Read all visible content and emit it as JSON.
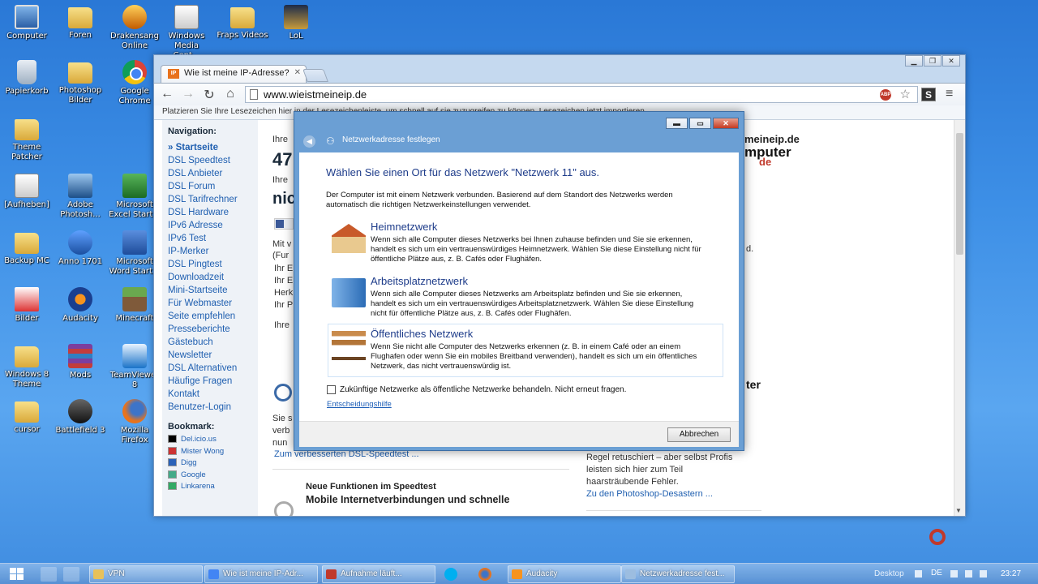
{
  "desktop_icons": [
    {
      "label": "Computer",
      "icon": "computer-icon"
    },
    {
      "label": "Foren",
      "icon": "folder-icon"
    },
    {
      "label": "Drakensang Online",
      "icon": "drakensang-icon"
    },
    {
      "label": "Windows Media Cent...",
      "icon": "media-center-icon"
    },
    {
      "label": "Fraps Videos",
      "icon": "folder-icon"
    },
    {
      "label": "LoL",
      "icon": "lol-icon"
    },
    {
      "label": "Papierkorb",
      "icon": "recycle-bin-icon"
    },
    {
      "label": "Photoshop Bilder",
      "icon": "folder-icon"
    },
    {
      "label": "Google Chrome",
      "icon": "chrome-icon"
    },
    {
      "label": "Theme Patcher",
      "icon": "folder-icon"
    },
    {
      "label": "[Aufheben]",
      "icon": "file-icon"
    },
    {
      "label": "Adobe Photosh...",
      "icon": "photoshop-icon"
    },
    {
      "label": "Microsoft Excel Start...",
      "icon": "excel-icon"
    },
    {
      "label": "Backup MC",
      "icon": "folder-icon"
    },
    {
      "label": "Anno 1701",
      "icon": "anno-icon"
    },
    {
      "label": "Microsoft Word Start...",
      "icon": "word-icon"
    },
    {
      "label": "Bilder",
      "icon": "pictures-icon"
    },
    {
      "label": "Audacity",
      "icon": "audacity-icon"
    },
    {
      "label": "Minecraft",
      "icon": "minecraft-icon"
    },
    {
      "label": "Windows 8 Theme",
      "icon": "folder-icon"
    },
    {
      "label": "Mods",
      "icon": "winrar-icon"
    },
    {
      "label": "TeamViewer 8",
      "icon": "teamviewer-icon"
    },
    {
      "label": "cursor",
      "icon": "folder-icon"
    },
    {
      "label": "Battlefield 3",
      "icon": "battlefield-icon"
    },
    {
      "label": "Mozilla Firefox",
      "icon": "firefox-icon"
    }
  ],
  "browser": {
    "tab_title": "Wie ist meine IP-Adresse?",
    "tab_favicon_text": "IP",
    "url": "www.wieistmeineip.de",
    "bookmarks_bar_text": "Platzieren Sie Ihre Lesezeichen hier in der Lesezeichenleiste, um schnell auf sie zuzugreifen zu können. Lesezeichen jetzt importieren...",
    "ext_icon_text": "S",
    "abp_text": "ABP",
    "page": {
      "nav_heading": "Navigation:",
      "nav_items": [
        "» Startseite",
        "DSL Speedtest",
        "DSL Anbieter",
        "DSL Forum",
        "DSL Tarifrechner",
        "DSL Hardware",
        "IPv6 Adresse",
        "IPv6 Test",
        "IP-Merker",
        "DSL Pingtest",
        "Downloadzeit",
        "Mini-Startseite",
        "Für Webmaster",
        "Seite empfehlen",
        "Presseberichte",
        "Gästebuch",
        "Newsletter",
        "DSL Alternativen",
        "Häufige Fragen",
        "Kontakt",
        "Benutzer-Login"
      ],
      "bookmark_heading": "Bookmark:",
      "bookmark_items": [
        "Del.icio.us",
        "Mister Wong",
        "Digg",
        "Google",
        "Linkarena"
      ],
      "main_fragments": {
        "ihre1": "Ihre",
        "num": "47",
        "ihre2": "Ihre",
        "nic": "nic",
        "mit": "Mit v",
        "fur": "(Fur",
        "ihr1": "Ihr E",
        "ihr2": "Ihr E",
        "herk": "Herk",
        "ihr3": "Ihr P",
        "ihre3": "Ihre",
        "sie": "Sie s",
        "verb": "verb",
        "nun": "nun",
        "speedtest_link": "Zum verbesserten DSL-Speedtest ...",
        "news_title": "Neue Funktionen im Speedtest",
        "news_headline": "Mobile Internetverbindungen und schnelle"
      },
      "right_fragments": {
        "logo_top": "meineip.de",
        "logo_bottom": "mputer",
        "logo_sub": "de",
        "d_text": "d.",
        "ter_text": "ter",
        "regel": "Regel retuschiert – aber selbst Profis",
        "leisten": "leisten sich hier zum Teil",
        "haar": "haarsträubende Fehler.",
        "photoshop_link": "Zu den Photoshop-Desastern ..."
      }
    }
  },
  "dialog": {
    "title": "Netzwerkadresse festlegen",
    "heading": "Wählen Sie einen Ort für das Netzwerk \"Netzwerk  11\" aus.",
    "intro": "Der Computer ist mit einem Netzwerk verbunden. Basierend auf dem Standort des Netzwerks werden automatisch die richtigen Netzwerkeinstellungen verwendet.",
    "options": [
      {
        "title": "Heimnetzwerk",
        "desc": "Wenn sich alle Computer dieses Netzwerks bei Ihnen zuhause befinden und Sie sie erkennen, handelt es sich um ein vertrauenswürdiges Heimnetzwerk. Wählen Sie diese Einstellung nicht für öffentliche Plätze aus, z. B. Cafés oder Flughäfen.",
        "icon": "home-network-icon"
      },
      {
        "title": "Arbeitsplatznetzwerk",
        "desc": "Wenn sich alle Computer dieses Netzwerks am Arbeitsplatz befinden und Sie sie erkennen, handelt es sich um ein vertrauenswürdiges Arbeitsplatznetzwerk. Wählen Sie diese Einstellung nicht für öffentliche Plätze aus, z. B. Cafés oder Flughäfen.",
        "icon": "work-network-icon"
      },
      {
        "title": "Öffentliches Netzwerk",
        "desc": "Wenn Sie nicht alle Computer des Netzwerks erkennen (z. B. in einem Café oder an einem Flughafen oder wenn Sie ein mobiles Breitband verwenden), handelt es sich um ein öffentliches Netzwerk, das nicht vertrauenswürdig ist.",
        "icon": "public-network-icon"
      }
    ],
    "checkbox_label": "Zukünftige Netzwerke als öffentliche Netzwerke behandeln. Nicht erneut fragen.",
    "help_link": "Entscheidungshilfe",
    "cancel_label": "Abbrechen"
  },
  "taskbar": {
    "items": [
      {
        "label": "VPN",
        "color": "#e8c15a"
      },
      {
        "label": "Wie ist meine IP-Adr...",
        "color": "#4285f4"
      },
      {
        "label": "Aufnahme läuft...",
        "color": "#c0392b"
      },
      {
        "label": "Audacity",
        "color": "#f7931e"
      },
      {
        "label": "Netzwerkadresse fest...",
        "color": "#9cbde0"
      }
    ],
    "desktop_label": "Desktop",
    "language": "DE",
    "clock": "23:27"
  },
  "colors": {
    "dialog_heading": "#1e3c8a",
    "link": "#1f5fb0",
    "desktop_bg": "#3d8fe6"
  }
}
